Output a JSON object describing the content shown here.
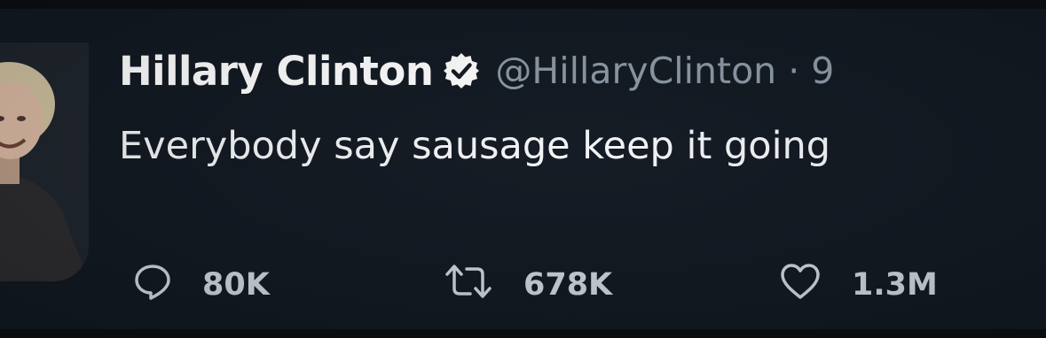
{
  "tweet": {
    "author_name": "Hillary Clinton",
    "handle_line": "@HillaryClinton · 9",
    "text": "Everybody say sausage keep it going",
    "verified": true
  },
  "actions": {
    "replies": "80K",
    "retweets": "678K",
    "likes": "1.3M"
  },
  "icons": {
    "reply": "reply-icon",
    "retweet": "retweet-icon",
    "like": "heart-icon",
    "verified": "verified-badge-icon"
  },
  "colors": {
    "background": "#111821",
    "name": "#ffffff",
    "handle": "#8b98a5",
    "text": "#f2f4f6",
    "action": "#c9d1d9"
  }
}
